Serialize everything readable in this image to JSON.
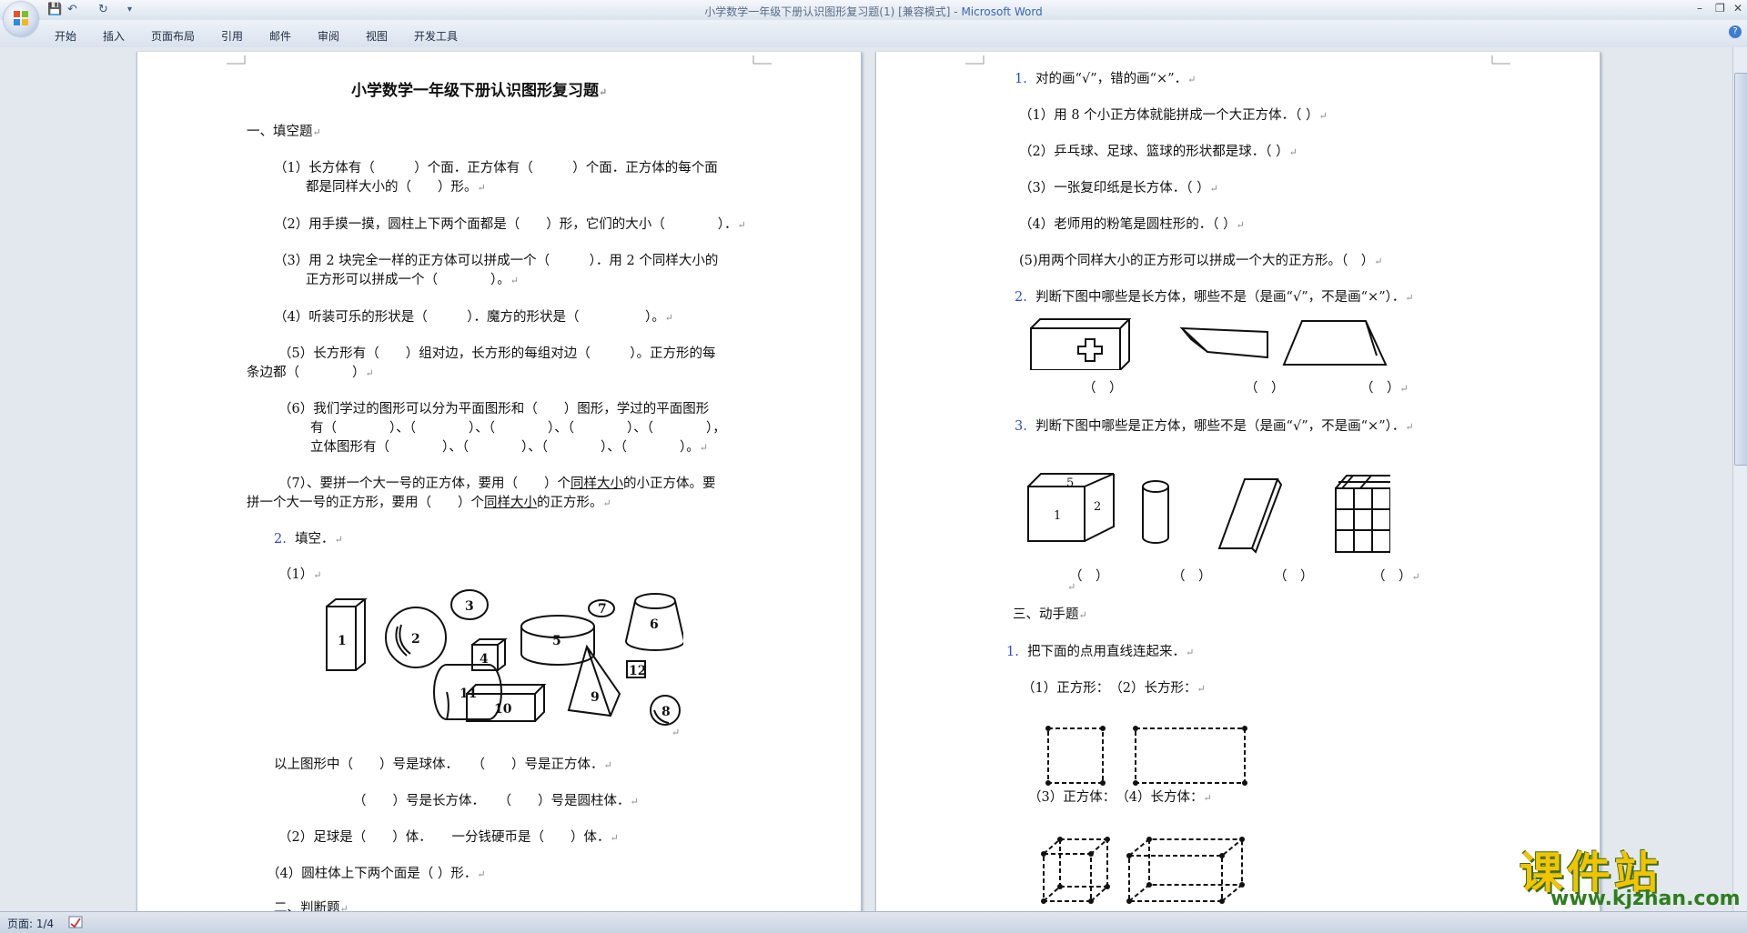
{
  "window": {
    "title": "小学数学一年级下册认识图形复习题(1) [兼容模式] -",
    "app_name": "Microsoft Word",
    "minimize": "–",
    "restore": "❐",
    "close": "✕"
  },
  "quick_access": {
    "save": "💾",
    "undo": "↶",
    "redo": "↻",
    "more": "▾"
  },
  "ribbon": {
    "tabs": [
      "开始",
      "插入",
      "页面布局",
      "引用",
      "邮件",
      "审阅",
      "视图",
      "开发工具"
    ],
    "help": "?"
  },
  "status_bar": {
    "page": "页面: 1/4"
  },
  "watermark": {
    "text": "课件站",
    "url": "www.kjzhan.com"
  },
  "page1": {
    "title": "小学数学一年级下册认识图形复习题",
    "s1_heading": "一、填空题",
    "q1_l1": "（1）长方体有（　　　）个面．正方体有（　　　）个面．正方体的每个面",
    "q1_l2": "都是同样大小的（　　）形。",
    "q2": "（2）用手摸一摸，圆柱上下两个面都是（　　）形，它们的大小（　　　　）．",
    "q3_l1": "（3）用 2 块完全一样的正方体可以拼成一个（　　　）．用 2 个同样大小的",
    "q3_l2": "正方形可以拼成一个（　　　　）。",
    "q4": "（4）听装可乐的形状是（　　　）．魔方的形状是（　　　　　）。",
    "q5_l1": "（5）长方形有（　　）组对边，长方形的每组对边（　　　）。正方形的每",
    "q5_l2": "条边都（　　　　）",
    "q6_l1": "（6）我们学过的图形可以分为平面图形和（　　）图形，学过的平面图形",
    "q6_l2": "有（　　　　）、（　　　　）、（　　　　）、（　　　　）、（　　　　），",
    "q6_l3": "立体图形有（　　　　）、（　　　　）、（　　　　）、（　　　　）。",
    "q7_l1_a": "（7）、要拼一个大一号的正方体，要用（　　）个",
    "q7_l1_u": "同样大小",
    "q7_l1_b": "的小正方体。要",
    "q7_l2_a": "拼一个大一号的正方形，要用（　　）个",
    "q7_l2_u": "同样大小",
    "q7_l2_b": "的正方形。",
    "q8_num": "2.",
    "q8_text": "填空．",
    "q8_sub": "（1）",
    "shape_labels": [
      "1",
      "2",
      "3",
      "4",
      "5",
      "6",
      "7",
      "8",
      "9",
      "10",
      "11",
      "12"
    ],
    "fill_l1": "以上图形中（　　）号是球体．　　（　　）号是正方体．",
    "fill_l2": "（　　）号是长方体．　　（　　）号是圆柱体．",
    "fill_l3": "（2）足球是（　　）体．　　一分钱硬币是（　　）体．",
    "fill_l4": "（4）圆柱体上下两个面是（ ）形．",
    "s2_heading": "二、判断题"
  },
  "page2": {
    "j1_num": "1.",
    "j1_text": "对的画“√”，错的画“×”．",
    "j1_a": "（1）用 8 个小正方体就能拼成一个大正方体．（ ）",
    "j1_b": "（2）乒乓球、足球、篮球的形状都是球．（ ）",
    "j1_c": "（3）一张复印纸是长方体．（ ）",
    "j1_d": "（4）老师用的粉笔是圆柱形的．（ ）",
    "j1_e": "(5)用两个同样大小的正方形可以拼成一个大的正方形。（　）",
    "j2_num": "2.",
    "j2_text": "判断下图中哪些是长方体，哪些不是（是画“√”，不是画“×”）．",
    "j2_blanks": [
      "（　）",
      "（　）",
      "（　）"
    ],
    "j3_num": "3.",
    "j3_text": "判断下图中哪些是正方体，哪些不是（是画“√”，不是画“×”）．",
    "j3_cube_labels": [
      "5",
      "1",
      "2"
    ],
    "j3_blanks": [
      "（　）",
      "（　）",
      "（　）",
      "（　）"
    ],
    "s3_heading": "三、动手题",
    "h1_num": "1.",
    "h1_text": "把下面的点用直线连起来．",
    "h1_a": "（1）正方形：　（2）长方形：",
    "h1_b": "（3）正方体：　（4）长方体："
  }
}
